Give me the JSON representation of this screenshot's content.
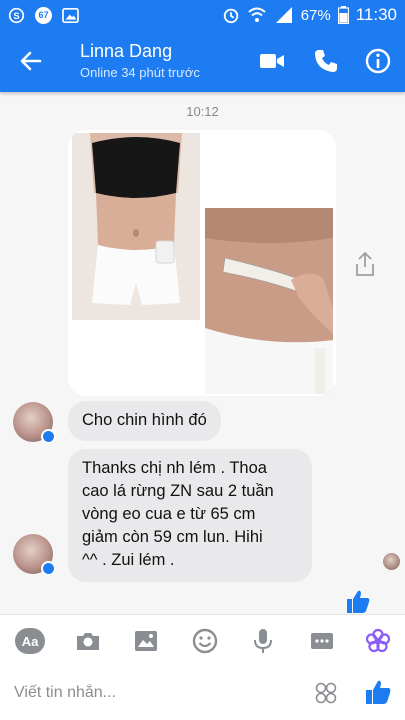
{
  "status_bar": {
    "badge_count": "67",
    "battery": "67%",
    "time": "11:30"
  },
  "header": {
    "contact_name": "Linna Dang",
    "contact_status": "Online 34 phút trước"
  },
  "chat": {
    "timestamp": "10:12",
    "messages": [
      {
        "text": "Cho chin hình đó"
      },
      {
        "text": "Thanks chị nh lém . Thoa\ncao lá rừng ZN sau 2 tuần\nvòng eo cua e từ 65 cm\ngiảm còn 59 cm lun. Hihi\n^^ . Zui lém ."
      }
    ]
  },
  "composer": {
    "aa_label": "Aa",
    "placeholder": "Viết tin nhắn..."
  },
  "colors": {
    "brand": "#1e7cf2",
    "bubble": "#e9e9ec",
    "icon_gray": "#8a8d91",
    "accent_purple": "#8b5cf6"
  },
  "icons": [
    "back-arrow",
    "video-camera",
    "phone",
    "info",
    "share",
    "camera",
    "gallery",
    "smiley",
    "microphone",
    "more",
    "flower",
    "thumbs-up",
    "emoji-grid"
  ]
}
